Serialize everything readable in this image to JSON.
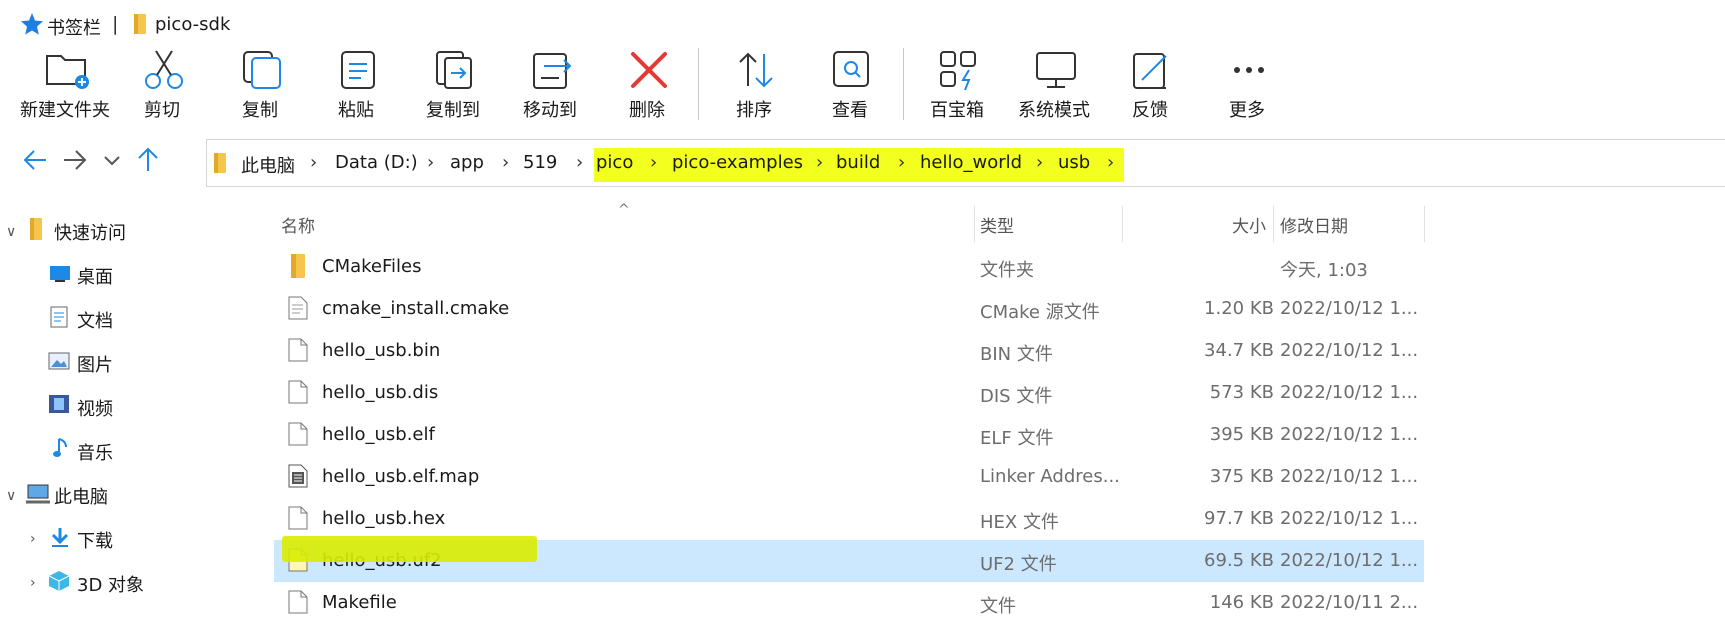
{
  "bookmarks": {
    "label": "书签栏",
    "separator": "|",
    "folder": "pico-sdk"
  },
  "toolbar": {
    "items": [
      {
        "label": "新建文件夹",
        "icon": "new-folder-icon"
      },
      {
        "label": "剪切",
        "icon": "scissors-icon"
      },
      {
        "label": "复制",
        "icon": "copy-icon"
      },
      {
        "label": "粘贴",
        "icon": "paste-icon"
      },
      {
        "label": "复制到",
        "icon": "copy-to-icon"
      },
      {
        "label": "移动到",
        "icon": "move-to-icon"
      },
      {
        "label": "删除",
        "icon": "delete-icon"
      },
      {
        "label": "排序",
        "icon": "sort-icon"
      },
      {
        "label": "查看",
        "icon": "view-icon"
      },
      {
        "label": "百宝箱",
        "icon": "toolbox-icon"
      },
      {
        "label": "系统模式",
        "icon": "monitor-icon"
      },
      {
        "label": "反馈",
        "icon": "feedback-icon"
      },
      {
        "label": "更多",
        "icon": "more-icon"
      }
    ]
  },
  "address": {
    "segments": [
      "此电脑",
      "Data (D:)",
      "app",
      "519",
      "pico",
      "pico-examples",
      "build",
      "hello_world",
      "usb"
    ],
    "highlight_color": "#f2ff1f"
  },
  "sidebar": {
    "quick_access": "快速访问",
    "items": [
      "桌面",
      "文档",
      "图片",
      "视频",
      "音乐"
    ],
    "this_pc": "此电脑",
    "pc_items": [
      "下载",
      "3D 对象"
    ]
  },
  "columns": {
    "name": "名称",
    "type": "类型",
    "size": "大小",
    "date": "修改日期"
  },
  "files": [
    {
      "name": "CMakeFiles",
      "type": "文件夹",
      "size": "",
      "date": "今天, 1:03",
      "icon": "folder-icon"
    },
    {
      "name": "cmake_install.cmake",
      "type": "CMake 源文件",
      "size": "1.20 KB",
      "date": "2022/10/12 1...",
      "icon": "text-file-icon"
    },
    {
      "name": "hello_usb.bin",
      "type": "BIN 文件",
      "size": "34.7 KB",
      "date": "2022/10/12 1...",
      "icon": "file-icon"
    },
    {
      "name": "hello_usb.dis",
      "type": "DIS 文件",
      "size": "573 KB",
      "date": "2022/10/12 1...",
      "icon": "file-icon"
    },
    {
      "name": "hello_usb.elf",
      "type": "ELF 文件",
      "size": "395 KB",
      "date": "2022/10/12 1...",
      "icon": "file-icon"
    },
    {
      "name": "hello_usb.elf.map",
      "type": "Linker Addres...",
      "size": "375 KB",
      "date": "2022/10/12 1...",
      "icon": "map-file-icon"
    },
    {
      "name": "hello_usb.hex",
      "type": "HEX 文件",
      "size": "97.7 KB",
      "date": "2022/10/12 1...",
      "icon": "file-icon"
    },
    {
      "name": "hello_usb.uf2",
      "type": "UF2 文件",
      "size": "69.5 KB",
      "date": "2022/10/12 1...",
      "icon": "file-icon",
      "selected": true
    },
    {
      "name": "Makefile",
      "type": "文件",
      "size": "146 KB",
      "date": "2022/10/11 2...",
      "icon": "file-icon"
    }
  ],
  "colors": {
    "accent_blue": "#1e88e5",
    "selection": "#cce8ff",
    "delete_red": "#e53935",
    "folder_yellow": "#f6c64c"
  }
}
